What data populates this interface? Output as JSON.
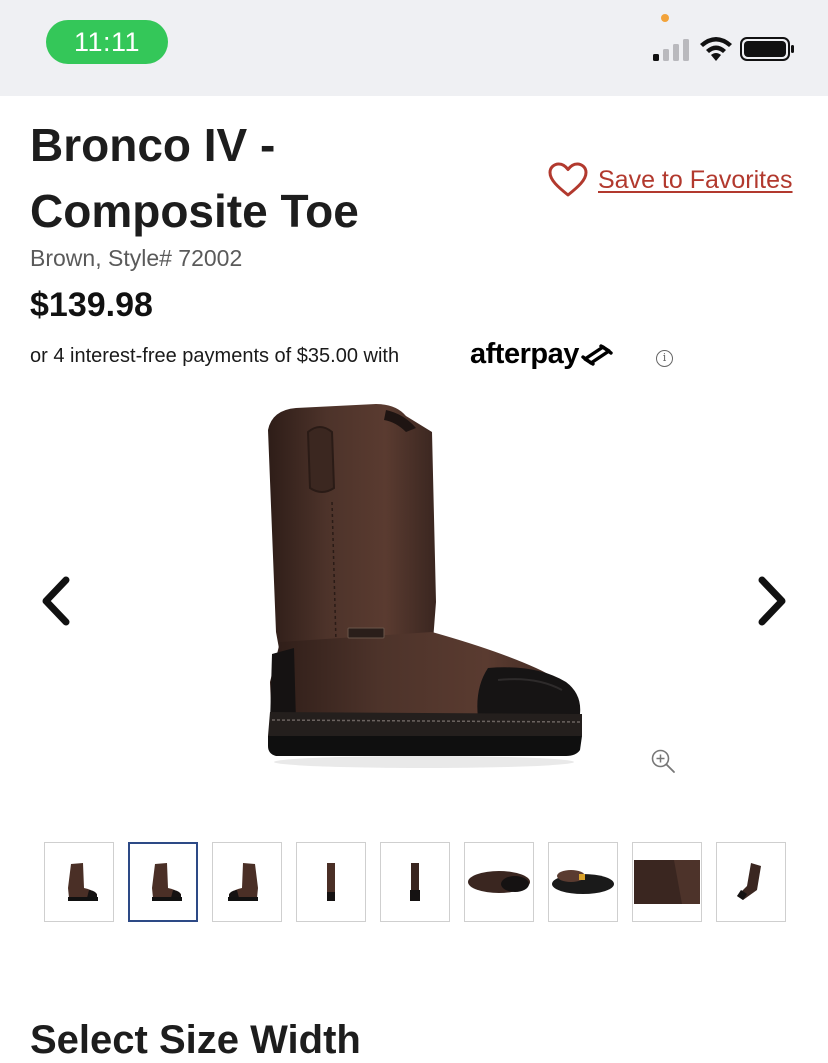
{
  "status_bar": {
    "time": "11:11"
  },
  "product": {
    "title": "Bronco IV - Composite Toe",
    "color_style": "Brown, Style# 72002",
    "price": "$139.98",
    "afterpay_text": "or 4 interest-free payments of $35.00 with",
    "afterpay_brand": "afterpay",
    "info_symbol": "i"
  },
  "favorites": {
    "label": "Save to Favorites"
  },
  "gallery": {
    "thumbnails": [
      {
        "view": "side-right",
        "selected": false
      },
      {
        "view": "side-right",
        "selected": true
      },
      {
        "view": "side-left",
        "selected": false
      },
      {
        "view": "front",
        "selected": false
      },
      {
        "view": "back",
        "selected": false
      },
      {
        "view": "top-flat",
        "selected": false
      },
      {
        "view": "sole",
        "selected": false
      },
      {
        "view": "detail-crop",
        "selected": false
      },
      {
        "view": "angled",
        "selected": false
      }
    ]
  },
  "section": {
    "heading": "Select Size Width"
  },
  "colors": {
    "accent": "#b2392e",
    "status_green": "#34c759",
    "thumb_selected": "#2d4a86"
  }
}
